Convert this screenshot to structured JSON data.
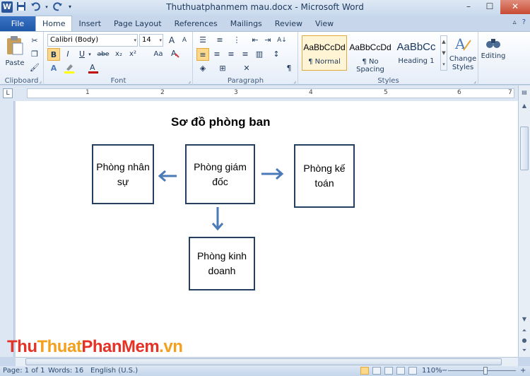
{
  "window": {
    "title": "Thuthuatphanmem mau.docx - Microsoft Word"
  },
  "qat": {
    "app_icon": "W",
    "save_icon": "floppy-icon",
    "undo_icon": "undo-icon",
    "redo_icon": "redo-icon"
  },
  "window_controls": {
    "minimize": "–",
    "maximize": "☐",
    "close": "✕"
  },
  "tabs": [
    {
      "label": "File"
    },
    {
      "label": "Home"
    },
    {
      "label": "Insert"
    },
    {
      "label": "Page Layout"
    },
    {
      "label": "References"
    },
    {
      "label": "Mailings"
    },
    {
      "label": "Review"
    },
    {
      "label": "View"
    }
  ],
  "ribbon": {
    "clipboard": {
      "label": "Clipboard",
      "paste_label": "Paste"
    },
    "font": {
      "label": "Font",
      "font_name": "Calibri (Body)",
      "font_size": "14",
      "bold": "B",
      "italic": "I",
      "underline": "U",
      "strike": "abe",
      "subscript": "x₂",
      "superscript": "x²",
      "grow": "A",
      "shrink": "A",
      "aa": "Aa",
      "clear": "A"
    },
    "paragraph": {
      "label": "Paragraph",
      "pilcrow": "¶"
    },
    "styles": {
      "label": "Styles",
      "items": [
        {
          "sample": "AaBbCcDd",
          "name": "¶ Normal"
        },
        {
          "sample": "AaBbCcDd",
          "name": "¶ No Spacing"
        },
        {
          "sample": "AaBbCc",
          "name": "Heading 1"
        }
      ],
      "change_styles": "Change Styles"
    },
    "editing": {
      "label": "Editing"
    }
  },
  "ruler": {
    "numbers": [
      "1",
      "2",
      "3",
      "4",
      "5",
      "6",
      "7"
    ]
  },
  "document": {
    "title": "Sơ đồ phòng ban",
    "boxes": {
      "hr": "Phòng nhân sự",
      "director": "Phòng giám đốc",
      "accounting": "Phòng kế toán",
      "business": "Phòng kinh doanh"
    }
  },
  "watermark": {
    "part1": "Thu",
    "part2": "Thuat",
    "part3": "PhanMem",
    "part4": ".vn"
  },
  "status": {
    "page": "Page: 1 of 1",
    "words": "Words: 16",
    "language": "English (U.S.)",
    "zoom": "110%",
    "zoom_minus": "−",
    "zoom_plus": "+"
  },
  "colors": {
    "accent": "#2b579a",
    "box_border": "#243f60",
    "arrow": "#4a7ab7"
  }
}
